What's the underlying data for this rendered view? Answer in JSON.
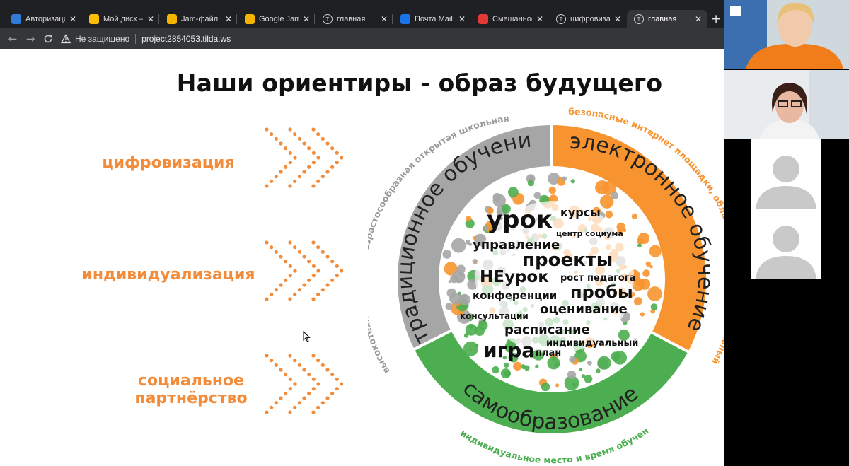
{
  "browser": {
    "tabs": [
      {
        "title": "Авторизация",
        "icon": "auth-icon",
        "color": "#2f7bd8",
        "active": false
      },
      {
        "title": "Мой диск – Go",
        "icon": "google-drive-icon",
        "color": "#fbbc04",
        "active": false
      },
      {
        "title": "Jam-файл без",
        "icon": "jamboard-icon",
        "color": "#f4b400",
        "active": false
      },
      {
        "title": "Google Jambo",
        "icon": "jamboard-icon",
        "color": "#f4b400",
        "active": false
      },
      {
        "title": "главная",
        "icon": "tilda-icon",
        "color": "#777777",
        "active": false
      },
      {
        "title": "Почта Mail.ru",
        "icon": "mail-icon",
        "color": "#1a73e8",
        "active": false
      },
      {
        "title": "Смешанное о",
        "icon": "youtube-icon",
        "color": "#e53935",
        "active": false
      },
      {
        "title": "цифровизаци",
        "icon": "tilda-icon",
        "color": "#777777",
        "active": false
      },
      {
        "title": "главная",
        "icon": "tilda-icon",
        "color": "#777777",
        "active": true
      }
    ],
    "new_tab_label": "+",
    "address": {
      "security": "Не защищено",
      "url": "project2854053.tilda.ws"
    }
  },
  "page": {
    "heading": "Наши ориентиры - образ будущего",
    "left_labels": [
      "цифровизация",
      "индивидуализация",
      "социальное партнёрство"
    ],
    "accent_color": "#f28c3a"
  },
  "diagram": {
    "colors": {
      "gray": "#a6a6a6",
      "orange": "#f7942f",
      "green": "#4cae50"
    },
    "sectors": {
      "gray": "традиционное обучение",
      "orange": "электронное обучение",
      "green": "самообразование"
    },
    "outer_labels": {
      "gray": "высокотехнологичная, возрастосообразная открытая школьная среда",
      "orange": "безопасные интернет площадки, облачные технологии, школьный портал",
      "green": "индивидуальное место и время обучения"
    },
    "words": [
      {
        "text": "урок"
      },
      {
        "text": "курсы"
      },
      {
        "text": "центр социума"
      },
      {
        "text": "управление"
      },
      {
        "text": "проекты"
      },
      {
        "text": "НЕурок"
      },
      {
        "text": "рост педагога"
      },
      {
        "text": "конференции"
      },
      {
        "text": "пробы"
      },
      {
        "text": "оценивание"
      },
      {
        "text": "консультации"
      },
      {
        "text": "расписание"
      },
      {
        "text": "индивидуальный"
      },
      {
        "text": "игра"
      },
      {
        "text": "план"
      }
    ]
  },
  "video": {
    "participants": [
      "participant-1",
      "participant-2",
      "participant-3",
      "participant-4"
    ]
  }
}
